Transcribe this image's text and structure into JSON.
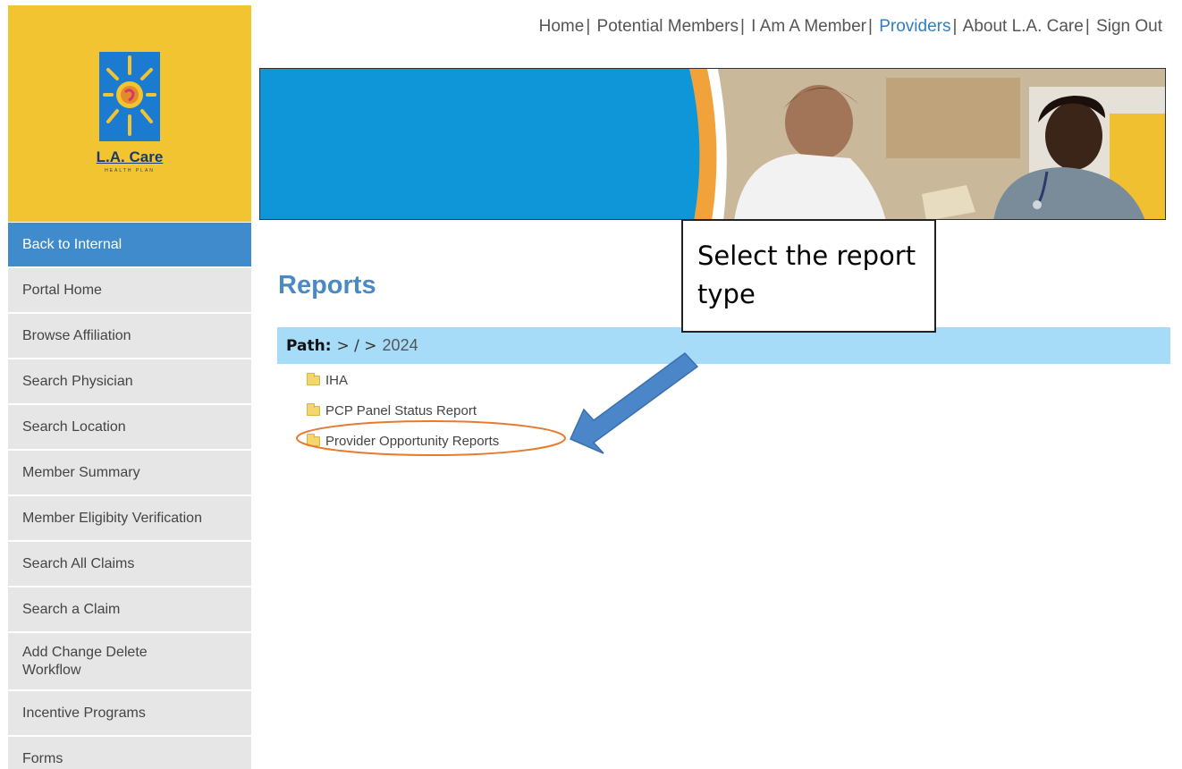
{
  "logo": {
    "name": "L.A. Care",
    "tagline": "HEALTH PLAN"
  },
  "top_nav": [
    {
      "label": "Home",
      "current": false
    },
    {
      "label": "Potential Members",
      "current": false
    },
    {
      "label": "I Am A Member",
      "current": false
    },
    {
      "label": "Providers",
      "current": true
    },
    {
      "label": "About L.A. Care",
      "current": false
    },
    {
      "label": "Sign Out",
      "current": false
    }
  ],
  "sidebar": {
    "items": [
      {
        "label": "Back to Internal",
        "active": true
      },
      {
        "label": "Portal Home"
      },
      {
        "label": "Browse Affiliation"
      },
      {
        "label": "Search Physician"
      },
      {
        "label": "Search Location"
      },
      {
        "label": "Member Summary"
      },
      {
        "label": "Member Eligibity Verification"
      },
      {
        "label": "Search All Claims"
      },
      {
        "label": "Search a Claim"
      },
      {
        "label": "Add Change Delete Workflow"
      },
      {
        "label": "Incentive Programs"
      },
      {
        "label": "Forms"
      }
    ]
  },
  "main": {
    "title": "Reports",
    "path": {
      "label": "Path:",
      "segments": "> / >",
      "current": "2024"
    },
    "folders": [
      {
        "label": "IHA"
      },
      {
        "label": "PCP Panel Status Report"
      },
      {
        "label": "Provider Opportunity Reports"
      }
    ]
  },
  "annotation": {
    "callout_text": "Select the report type",
    "highlight_color": "#e87a2e",
    "arrow_color": "#4a86c8"
  },
  "colors": {
    "logo_bg": "#f2c432",
    "sidebar_active": "#3f8bcb",
    "sidebar_bg": "#e6e6e6",
    "title_blue": "#4a8ac4",
    "path_bar": "#a7dcf8",
    "banner_blue": "#0e96d8"
  }
}
